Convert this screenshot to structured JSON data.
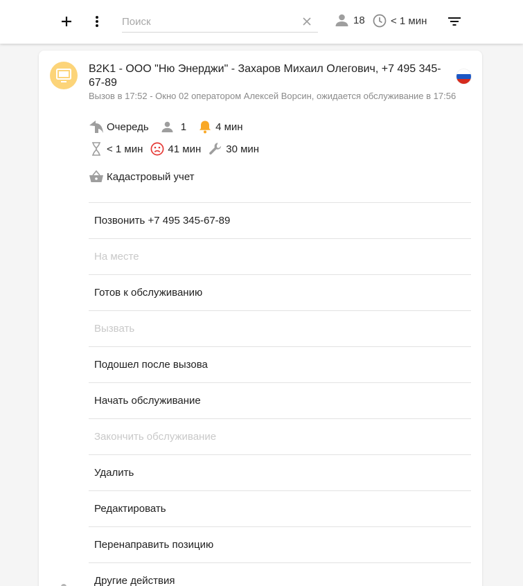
{
  "toolbar": {
    "add_icon": "plus-icon",
    "menu_icon": "more-vert-icon",
    "search": {
      "placeholder": "Поиск",
      "value": ""
    },
    "clear_icon": "close-icon",
    "queue_count": "18",
    "wait_time": "< 1 мин",
    "filter_icon": "filter-icon"
  },
  "ticket": {
    "avatar_icon": "monitor-icon",
    "avatar_color": "#fcd479",
    "title": "B2K1 - ООО \"Ню Энерджи\" - Захаров Михаил Олегович, +7 495 345-67-89",
    "flag_icon": "russia-flag-icon",
    "subtitle": "Вызов в 17:52 - Окно 02 оператором Алексей Ворсин, ожидается обслуживание в 17:56",
    "status": {
      "queue_label": "Очередь",
      "people": "1",
      "bell_time": "4 мин",
      "hourglass_time": "< 1 мин",
      "sad_time": "41 мин",
      "service_time": "30 мин"
    },
    "service": "Кадастровый учет",
    "accent_bell": "#f9a825",
    "accent_sad": "#e53935"
  },
  "actions": [
    {
      "label": "Позвонить +7 495 345-67-89",
      "disabled": false
    },
    {
      "label": "На месте",
      "disabled": true
    },
    {
      "label": "Готов к обслуживанию",
      "disabled": false
    },
    {
      "label": "Вызвать",
      "disabled": true
    },
    {
      "label": "Подошел после вызова",
      "disabled": false
    },
    {
      "label": "Начать обслуживание",
      "disabled": false
    },
    {
      "label": "Закончить обслуживание",
      "disabled": true
    },
    {
      "label": "Удалить",
      "disabled": false
    },
    {
      "label": "Редактировать",
      "disabled": false
    },
    {
      "label": "Перенаправить позицию",
      "disabled": false
    },
    {
      "label": "Другие действия",
      "disabled": false
    }
  ]
}
